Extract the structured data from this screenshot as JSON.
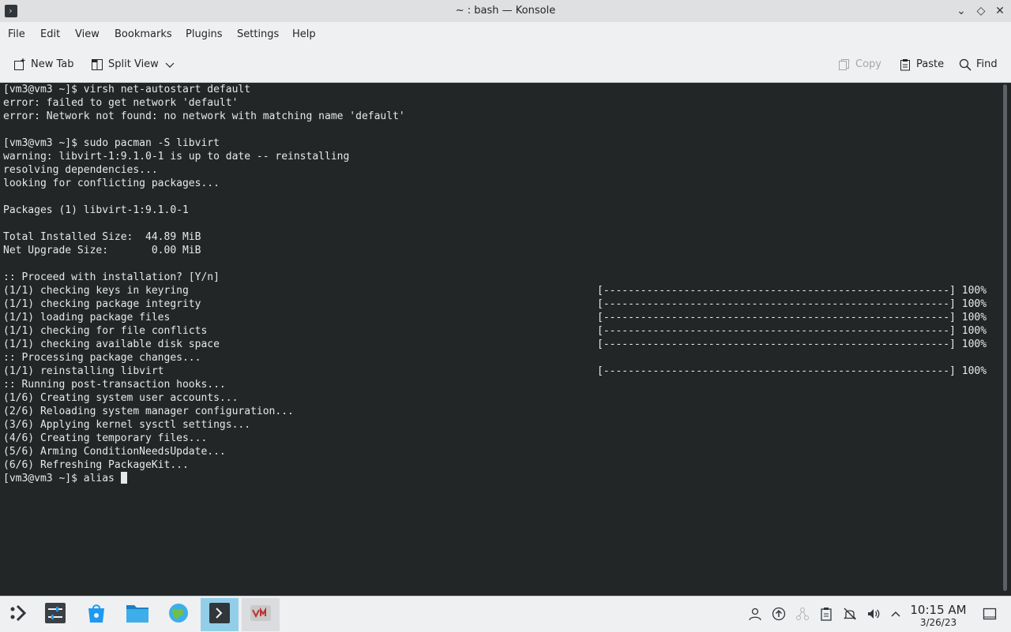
{
  "window": {
    "title": "~ : bash — Konsole",
    "app_icon_glyph": "›",
    "controls": {
      "minimize_glyph": "⌄",
      "maximize_glyph": "◇",
      "close_glyph": "✕"
    }
  },
  "menubar": {
    "items": [
      "File",
      "Edit",
      "View",
      "Bookmarks",
      "Plugins",
      "Settings",
      "Help"
    ]
  },
  "toolbar": {
    "new_tab": "New Tab",
    "split_view": "Split View",
    "copy": "Copy",
    "paste": "Paste",
    "find": "Find"
  },
  "terminal": {
    "lines": [
      "[vm3@vm3 ~]$ virsh net-autostart default",
      "error: failed to get network 'default'",
      "error: Network not found: no network with matching name 'default'",
      "",
      "[vm3@vm3 ~]$ sudo pacman -S libvirt",
      "warning: libvirt-1:9.1.0-1 is up to date -- reinstalling",
      "resolving dependencies...",
      "looking for conflicting packages...",
      "",
      "Packages (1) libvirt-1:9.1.0-1",
      "",
      "Total Installed Size:  44.89 MiB",
      "Net Upgrade Size:       0.00 MiB",
      "",
      ":: Proceed with installation? [Y/n]",
      "(1/1) checking keys in keyring",
      "(1/1) checking package integrity",
      "(1/1) loading package files",
      "(1/1) checking for file conflicts",
      "(1/1) checking available disk space",
      ":: Processing package changes...",
      "(1/1) reinstalling libvirt",
      ":: Running post-transaction hooks...",
      "(1/6) Creating system user accounts...",
      "(2/6) Reloading system manager configuration...",
      "(3/6) Applying kernel sysctl settings...",
      "(4/6) Creating temporary files...",
      "(5/6) Arming ConditionNeedsUpdate...",
      "(6/6) Refreshing PackageKit...",
      "[vm3@vm3 ~]$ alias "
    ],
    "progress_bar": "[--------------------------------------------------------] 100%"
  },
  "taskbar": {
    "clock_time": "10:15 AM",
    "clock_date": "3/26/23"
  },
  "colors": {
    "terminal_bg": "#232627",
    "terminal_fg": "#e8e8e8",
    "chrome_bg": "#eff0f1",
    "active_task": "#93cee9"
  }
}
